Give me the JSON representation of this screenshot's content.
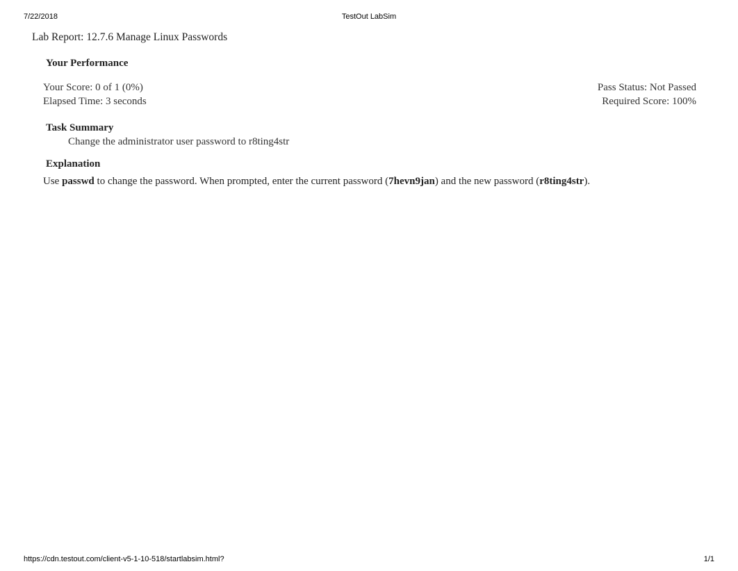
{
  "header": {
    "date": "7/22/2018",
    "app_title": "TestOut LabSim"
  },
  "report": {
    "title": "Lab Report: 12.7.6 Manage Linux Passwords"
  },
  "performance": {
    "heading": "Your Performance",
    "score_text": "Your Score: 0 of 1 (0%)",
    "pass_status_text": "Pass Status: Not Passed",
    "elapsed_text": "Elapsed Time: 3 seconds",
    "required_text": "Required Score: 100%"
  },
  "task_summary": {
    "heading": "Task Summary",
    "items": [
      "Change the administrator user password to r8ting4str"
    ]
  },
  "explanation": {
    "heading": "Explanation",
    "pre_text": "Use ",
    "cmd": "passwd",
    "mid1": " to change the password. When prompted, enter the current password (",
    "current_pw": "7hevn9jan",
    "mid2": ") and the new password (",
    "new_pw": "r8ting4str",
    "post_text": ")."
  },
  "footer": {
    "url": "https://cdn.testout.com/client-v5-1-10-518/startlabsim.html?",
    "page": "1/1"
  }
}
